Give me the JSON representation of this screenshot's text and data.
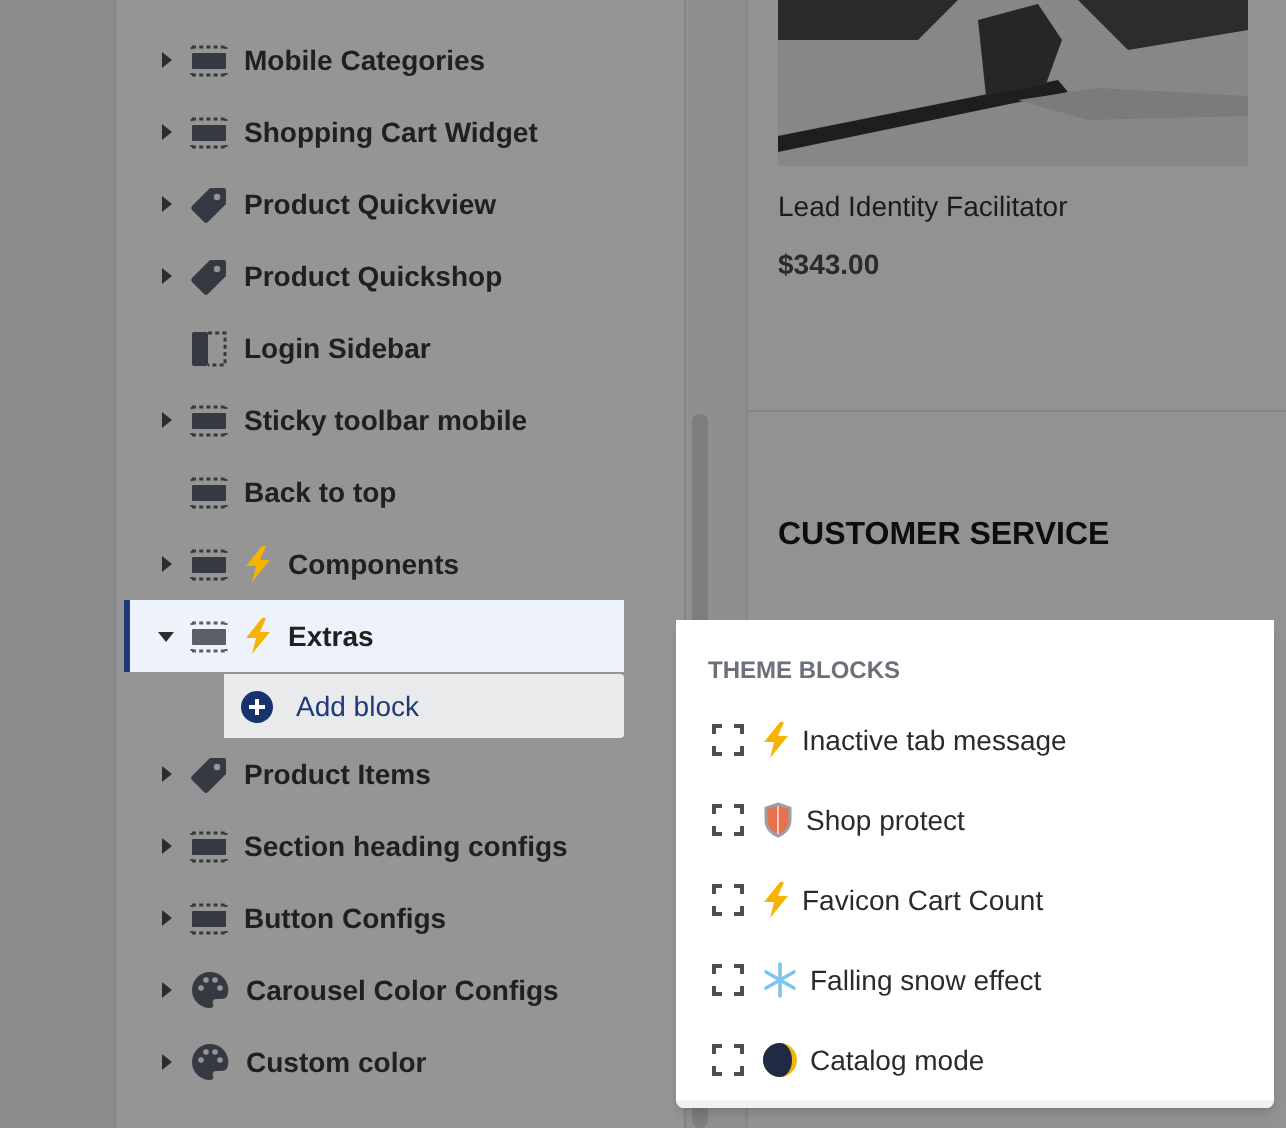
{
  "tree": {
    "items": [
      {
        "label": "Mobile Categories",
        "kind": "section",
        "bolt": false,
        "expanded": false,
        "selected": false
      },
      {
        "label": "Shopping Cart Widget",
        "kind": "section",
        "bolt": false,
        "expanded": false,
        "selected": false
      },
      {
        "label": "Product Quickview",
        "kind": "tag",
        "bolt": false,
        "expanded": false,
        "selected": false
      },
      {
        "label": "Product Quickshop",
        "kind": "tag",
        "bolt": false,
        "expanded": false,
        "selected": false
      },
      {
        "label": "Login Sidebar",
        "kind": "sidebar",
        "bolt": false,
        "selected": false
      },
      {
        "label": "Sticky toolbar mobile",
        "kind": "section",
        "bolt": false,
        "expanded": false,
        "selected": false
      },
      {
        "label": "Back to top",
        "kind": "section",
        "bolt": false,
        "selected": false
      },
      {
        "label": "Components",
        "kind": "section",
        "bolt": true,
        "expanded": false,
        "selected": false
      },
      {
        "label": "Extras",
        "kind": "section",
        "bolt": true,
        "expanded": true,
        "selected": true,
        "children": [
          {
            "label": "Add block",
            "kind": "add"
          }
        ]
      },
      {
        "label": "Product Items",
        "kind": "tag",
        "bolt": false,
        "expanded": false,
        "selected": false
      },
      {
        "label": "Section heading configs",
        "kind": "section",
        "bolt": false,
        "expanded": false,
        "selected": false
      },
      {
        "label": "Button Configs",
        "kind": "section",
        "bolt": false,
        "expanded": false,
        "selected": false
      },
      {
        "label": "Carousel Color Configs",
        "kind": "palette",
        "bolt": false,
        "expanded": false,
        "selected": false
      },
      {
        "label": "Custom color",
        "kind": "palette",
        "bolt": false,
        "expanded": false,
        "selected": false
      }
    ]
  },
  "preview": {
    "product": {
      "title": "Lead Identity Facilitator",
      "price": "$343.00"
    },
    "heading": "CUSTOMER SERVICE"
  },
  "popup": {
    "heading": "THEME BLOCKS",
    "items": [
      {
        "label": "Inactive tab message",
        "kind": "bolt"
      },
      {
        "label": "Shop protect",
        "kind": "shield"
      },
      {
        "label": "Favicon Cart Count",
        "kind": "bolt"
      },
      {
        "label": "Falling snow effect",
        "kind": "snow"
      },
      {
        "label": "Catalog mode",
        "kind": "moon"
      }
    ]
  }
}
